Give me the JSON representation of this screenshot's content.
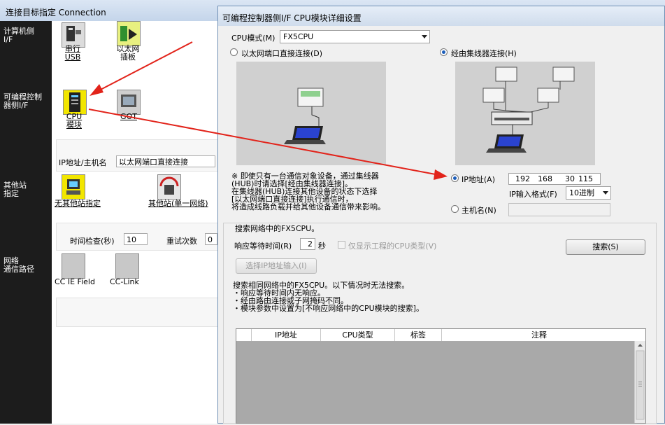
{
  "background_window": {
    "title": "连接目标指定 Connection",
    "rail": {
      "pc_side": "计算机侧\nI/F",
      "plc_side": "可编程控制\n器侧I/F",
      "other_station": "其他站\n指定",
      "network_route": "网络\n通信路径"
    },
    "pc_if": [
      {
        "label": "串行\nUSB",
        "icon": "serial-usb-icon"
      },
      {
        "label": "以太网\n插板",
        "icon": "ethernet-board-icon"
      }
    ],
    "plc_if": [
      {
        "label": "CPU\n模块",
        "icon": "cpu-module-icon"
      },
      {
        "label": "GOT",
        "icon": "got-icon"
      }
    ],
    "ip_label": "IP地址/主机名",
    "ip_value": "以太网端口直接连接",
    "other_station": [
      {
        "label": "无其他站指定",
        "icon": "no-other-station-icon"
      },
      {
        "label": "其他站(单一网络)",
        "icon": "other-station-icon"
      }
    ],
    "time_check_label": "时间检查(秒)",
    "time_check_value": "10",
    "retry_label": "重试次数",
    "retry_value": "0",
    "network": [
      {
        "label": "CC IE Field",
        "icon": "cc-ie-field-icon"
      },
      {
        "label": "CC-Link",
        "icon": "cc-link-icon"
      }
    ]
  },
  "dialog": {
    "title": "可编程控制器侧I/F CPU模块详细设置",
    "cpu_mode_label": "CPU模式(M)",
    "cpu_mode_value": "FX5CPU",
    "direct_label": "以太网端口直接连接(D)",
    "hub_label": "经由集线器连接(H)",
    "note": "※ 即使只有一台通信对象设备，通过集线器\n(HUB)时请选择[经由集线器连接]。\n在集线器(HUB)连接其他设备的状态下选择\n[以太网端口直接连接]执行通信时，\n将造成线路负载并给其他设备通信带来影响。",
    "ip_label": "IP地址(A)",
    "ip": [
      "192",
      "168",
      "30",
      "115"
    ],
    "ip_format_label": "IP输入格式(F)",
    "ip_format_value": "10进制",
    "hostname_label": "主机名(N)",
    "hostname_value": "",
    "search_group_title": "搜索网络中的FX5CPU。",
    "response_label": "响应等待时间(R)",
    "response_value": "2",
    "seconds": "秒",
    "only_project_label": "仅显示工程的CPU类型(V)",
    "search_button": "搜索(S)",
    "select_ip_button": "选择IP地址输入(I)",
    "search_note": "搜索相同网络中的FX5CPU。以下情况时无法搜索。\n・响应等待时间内无响应。\n・经由路由连接或子网掩码不同。\n・模块参数中设置为[不响应网络中的CPU模块的搜索]。",
    "columns": [
      "IP地址",
      "CPU类型",
      "标签",
      "注释"
    ]
  },
  "colors": {
    "arrow": "#e2231a",
    "rail": "#1c1c1c",
    "radio_dot": "#1b5dba"
  }
}
